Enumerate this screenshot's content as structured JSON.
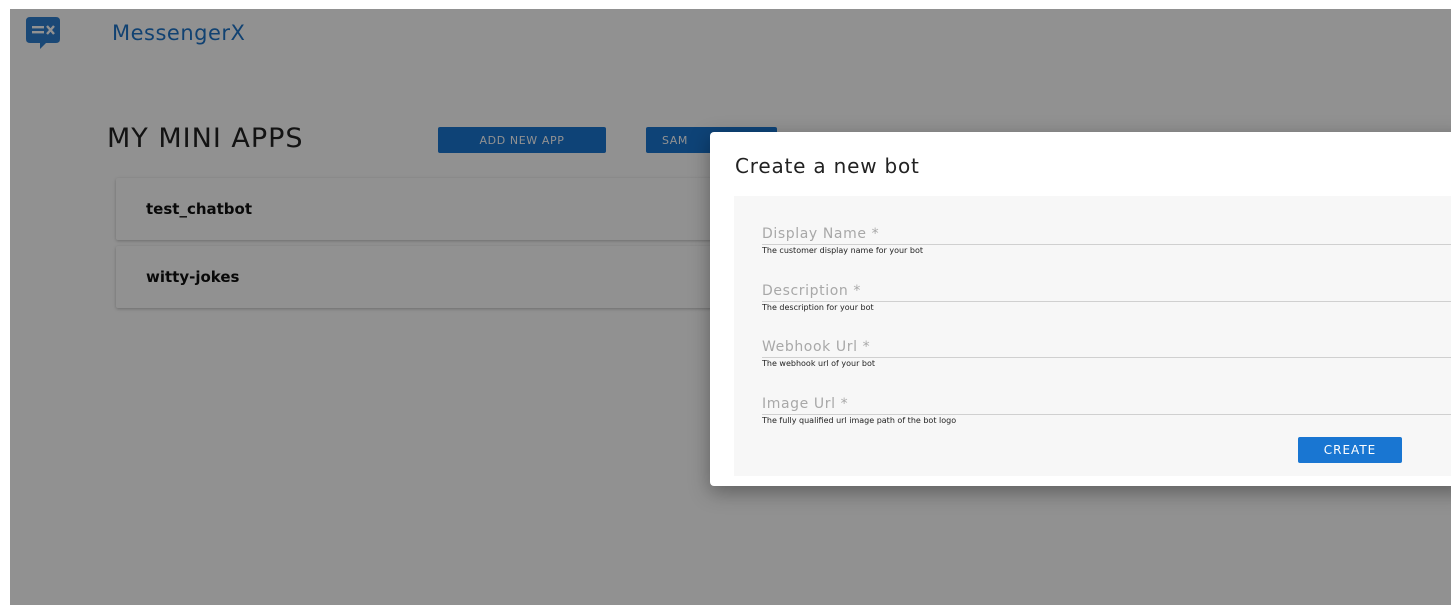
{
  "header": {
    "brand": "MessengerX",
    "logo_icon": "chat-bubble-x-icon",
    "brand_color": "#1f75c9"
  },
  "main": {
    "title": "MY MINI APPS",
    "add_button": "ADD NEW APP",
    "samples_button": "SAM",
    "apps": [
      {
        "name": "test_chatbot"
      },
      {
        "name": "witty-jokes"
      }
    ]
  },
  "modal": {
    "title": "Create a new bot",
    "fields": [
      {
        "placeholder": "Display Name *",
        "helper": "The customer display name for your bot"
      },
      {
        "placeholder": "Description *",
        "helper": "The description for your bot"
      },
      {
        "placeholder": "Webhook Url *",
        "helper": "The webhook url of your bot"
      },
      {
        "placeholder": "Image Url *",
        "helper": "The fully qualified url image path of the bot logo"
      }
    ],
    "create_button": "CREATE"
  },
  "colors": {
    "accent": "#1976d2",
    "backdrop": "rgba(0,0,0,0.43)"
  }
}
